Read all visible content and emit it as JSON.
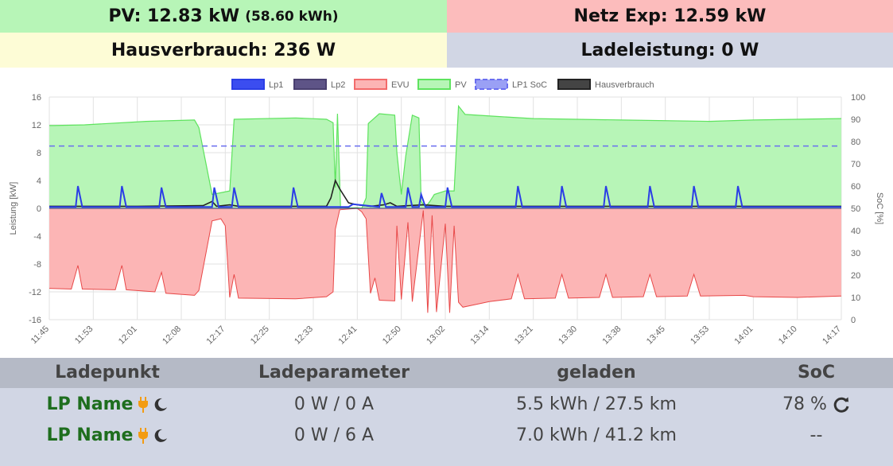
{
  "tiles": {
    "pv_main": "PV: 12.83 kW",
    "pv_sub": "(58.60 kWh)",
    "netz": "Netz Exp: 12.59 kW",
    "hausverbrauch": "Hausverbrauch: 236 W",
    "ladeleistung": "Ladeleistung: 0 W"
  },
  "chart_data": {
    "type": "area",
    "ylabel": "Leistung [kW]",
    "y2label": "SoC [%]",
    "ylim": [
      -16,
      16
    ],
    "y2lim": [
      0,
      100
    ],
    "yticks": [
      "16",
      "12",
      "8",
      "4",
      "0",
      "-4",
      "-8",
      "-12",
      "-16"
    ],
    "y2ticks": [
      "100",
      "90",
      "80",
      "70",
      "60",
      "50",
      "40",
      "30",
      "20",
      "10",
      "0"
    ],
    "xticks": [
      "11:45",
      "11:53",
      "12:01",
      "12:08",
      "12:17",
      "12:25",
      "12:33",
      "12:41",
      "12:50",
      "13:02",
      "13:14",
      "13:21",
      "13:30",
      "13:38",
      "13:45",
      "13:53",
      "14:01",
      "14:10",
      "14:17"
    ],
    "grid": true,
    "legend_position": "top",
    "legend": [
      {
        "name": "Lp1",
        "color": "#2b3ee6",
        "dashed": false
      },
      {
        "name": "Lp2",
        "color": "#4a4070",
        "dashed": false
      },
      {
        "name": "EVU",
        "color": "#f36b6b",
        "dashed": false
      },
      {
        "name": "PV",
        "color": "#5ee35e",
        "dashed": false
      },
      {
        "name": "LP1 SoC",
        "color": "#6a6ef0",
        "dashed": true
      },
      {
        "name": "Hausverbrauch",
        "color": "#222222",
        "dashed": false
      }
    ],
    "series": [
      {
        "name": "PV",
        "axis": "left",
        "points": [
          [
            0,
            11.9
          ],
          [
            0.1,
            11.9
          ],
          [
            0.8,
            12.0
          ],
          [
            2.2,
            12.5
          ],
          [
            3.3,
            12.7
          ],
          [
            3.4,
            11.6
          ],
          [
            3.7,
            2.0
          ],
          [
            4.1,
            2.5
          ],
          [
            4.2,
            12.8
          ],
          [
            5.6,
            13.0
          ],
          [
            6.3,
            12.8
          ],
          [
            6.45,
            12.3
          ],
          [
            6.5,
            3.0
          ],
          [
            6.55,
            13.6
          ],
          [
            6.62,
            0
          ],
          [
            7.0,
            0.1
          ],
          [
            7.1,
            0
          ],
          [
            7.2,
            1.5
          ],
          [
            7.25,
            12.2
          ],
          [
            7.5,
            13.6
          ],
          [
            7.85,
            13.4
          ],
          [
            7.9,
            8.0
          ],
          [
            8.0,
            2.0
          ],
          [
            8.1,
            7.5
          ],
          [
            8.25,
            13.4
          ],
          [
            8.4,
            13.0
          ],
          [
            8.45,
            1.0
          ],
          [
            8.55,
            0.2
          ],
          [
            8.65,
            1.0
          ],
          [
            8.75,
            2.0
          ],
          [
            9.0,
            2.5
          ],
          [
            9.2,
            2.5
          ],
          [
            9.3,
            14.7
          ],
          [
            9.45,
            13.5
          ],
          [
            10.2,
            13.2
          ],
          [
            11.0,
            12.9
          ],
          [
            13.0,
            12.7
          ],
          [
            15.0,
            12.5
          ],
          [
            16.0,
            12.7
          ],
          [
            17.0,
            12.8
          ],
          [
            18.0,
            12.9
          ]
        ]
      },
      {
        "name": "EVU",
        "axis": "left",
        "points": [
          [
            0,
            -11.5
          ],
          [
            0.5,
            -11.6
          ],
          [
            0.65,
            -8.2
          ],
          [
            0.75,
            -11.6
          ],
          [
            1.5,
            -11.7
          ],
          [
            1.65,
            -8.2
          ],
          [
            1.75,
            -11.7
          ],
          [
            2.4,
            -12.0
          ],
          [
            2.55,
            -9.2
          ],
          [
            2.65,
            -12.2
          ],
          [
            3.3,
            -12.5
          ],
          [
            3.4,
            -11.8
          ],
          [
            3.7,
            -1.8
          ],
          [
            3.9,
            -1.5
          ],
          [
            4.0,
            -2.5
          ],
          [
            4.1,
            -12.8
          ],
          [
            4.2,
            -9.5
          ],
          [
            4.3,
            -12.9
          ],
          [
            5.6,
            -13.0
          ],
          [
            6.3,
            -12.7
          ],
          [
            6.45,
            -12.0
          ],
          [
            6.5,
            -3.0
          ],
          [
            6.6,
            -0.2
          ],
          [
            7.0,
            0
          ],
          [
            7.1,
            -0.5
          ],
          [
            7.2,
            -1.5
          ],
          [
            7.3,
            -12.2
          ],
          [
            7.4,
            -10.0
          ],
          [
            7.5,
            -13.2
          ],
          [
            7.85,
            -13.3
          ],
          [
            7.9,
            -2.5
          ],
          [
            8.0,
            -13.1
          ],
          [
            8.15,
            -2.0
          ],
          [
            8.25,
            -13.4
          ],
          [
            8.5,
            -0.3
          ],
          [
            8.6,
            -15.0
          ],
          [
            8.7,
            -1.0
          ],
          [
            8.8,
            -14.9
          ],
          [
            9.0,
            -2.2
          ],
          [
            9.1,
            -15.0
          ],
          [
            9.2,
            -2.5
          ],
          [
            9.3,
            -13.5
          ],
          [
            9.4,
            -14.2
          ],
          [
            10.0,
            -13.4
          ],
          [
            10.5,
            -13.0
          ],
          [
            10.65,
            -9.5
          ],
          [
            10.8,
            -13.0
          ],
          [
            11.5,
            -12.9
          ],
          [
            11.65,
            -9.5
          ],
          [
            11.8,
            -12.9
          ],
          [
            12.5,
            -12.8
          ],
          [
            12.65,
            -9.5
          ],
          [
            12.8,
            -12.8
          ],
          [
            13.5,
            -12.7
          ],
          [
            13.65,
            -9.5
          ],
          [
            13.8,
            -12.7
          ],
          [
            14.5,
            -12.6
          ],
          [
            14.65,
            -9.5
          ],
          [
            14.8,
            -12.6
          ],
          [
            15.8,
            -12.5
          ],
          [
            16.0,
            -12.7
          ],
          [
            17.0,
            -12.8
          ],
          [
            18.0,
            -12.6
          ]
        ]
      },
      {
        "name": "Lp1",
        "axis": "left",
        "points": [
          [
            0,
            0.2
          ],
          [
            0.6,
            0.2
          ],
          [
            0.65,
            3.2
          ],
          [
            0.75,
            0.2
          ],
          [
            1.6,
            0.2
          ],
          [
            1.65,
            3.2
          ],
          [
            1.75,
            0.2
          ],
          [
            2.5,
            0.2
          ],
          [
            2.55,
            3.0
          ],
          [
            2.65,
            0.2
          ],
          [
            3.7,
            0.2
          ],
          [
            3.75,
            3.0
          ],
          [
            3.85,
            0.2
          ],
          [
            4.15,
            0.2
          ],
          [
            4.2,
            3.0
          ],
          [
            4.3,
            0.2
          ],
          [
            5.5,
            0.2
          ],
          [
            5.55,
            3.0
          ],
          [
            5.65,
            0.2
          ],
          [
            6.8,
            0.2
          ],
          [
            6.9,
            0.6
          ],
          [
            7.5,
            0.2
          ],
          [
            7.55,
            2.2
          ],
          [
            7.65,
            0.2
          ],
          [
            8.1,
            0.2
          ],
          [
            8.15,
            3.0
          ],
          [
            8.25,
            0.2
          ],
          [
            8.4,
            0.2
          ],
          [
            8.45,
            2.0
          ],
          [
            8.55,
            0.2
          ],
          [
            9.0,
            0.2
          ],
          [
            9.05,
            3.0
          ],
          [
            9.15,
            0.2
          ],
          [
            10.6,
            0.2
          ],
          [
            10.65,
            3.2
          ],
          [
            10.75,
            0.2
          ],
          [
            11.6,
            0.2
          ],
          [
            11.65,
            3.2
          ],
          [
            11.75,
            0.2
          ],
          [
            12.6,
            0.2
          ],
          [
            12.65,
            3.2
          ],
          [
            12.75,
            0.2
          ],
          [
            13.6,
            0.2
          ],
          [
            13.65,
            3.2
          ],
          [
            13.75,
            0.2
          ],
          [
            14.6,
            0.2
          ],
          [
            14.65,
            3.2
          ],
          [
            14.75,
            0.2
          ],
          [
            15.6,
            0.2
          ],
          [
            15.65,
            3.2
          ],
          [
            15.75,
            0.2
          ],
          [
            18.0,
            0.2
          ]
        ]
      },
      {
        "name": "Hausverbrauch",
        "axis": "left",
        "points": [
          [
            0,
            0.3
          ],
          [
            2.0,
            0.3
          ],
          [
            3.5,
            0.4
          ],
          [
            3.7,
            1.0
          ],
          [
            3.8,
            0.3
          ],
          [
            4.1,
            0.5
          ],
          [
            4.3,
            0.3
          ],
          [
            5.0,
            0.3
          ],
          [
            6.3,
            0.3
          ],
          [
            6.4,
            1.5
          ],
          [
            6.5,
            4.0
          ],
          [
            6.6,
            2.8
          ],
          [
            6.8,
            0.8
          ],
          [
            7.0,
            0.5
          ],
          [
            7.3,
            0.3
          ],
          [
            7.6,
            0.5
          ],
          [
            7.75,
            0.8
          ],
          [
            7.9,
            0.3
          ],
          [
            8.5,
            0.5
          ],
          [
            9.0,
            0.3
          ],
          [
            18.0,
            0.3
          ]
        ]
      },
      {
        "name": "LP1 SoC",
        "axis": "right",
        "points": [
          [
            0,
            78
          ],
          [
            18.0,
            78
          ]
        ]
      }
    ]
  },
  "table": {
    "headers": [
      "Ladepunkt",
      "Ladeparameter",
      "geladen",
      "SoC"
    ],
    "rows": [
      {
        "name": "LP Name",
        "param": "0 W / 0 A",
        "geladen": "5.5 kWh / 27.5 km",
        "soc": "78 %",
        "soc_icon": "refresh-icon"
      },
      {
        "name": "LP Name",
        "param": "0 W / 6 A",
        "geladen": "7.0 kWh / 41.2 km",
        "soc": "--",
        "soc_icon": ""
      }
    ],
    "icon_colors": {
      "plug": "#f39c12",
      "moon": "#333333"
    }
  }
}
